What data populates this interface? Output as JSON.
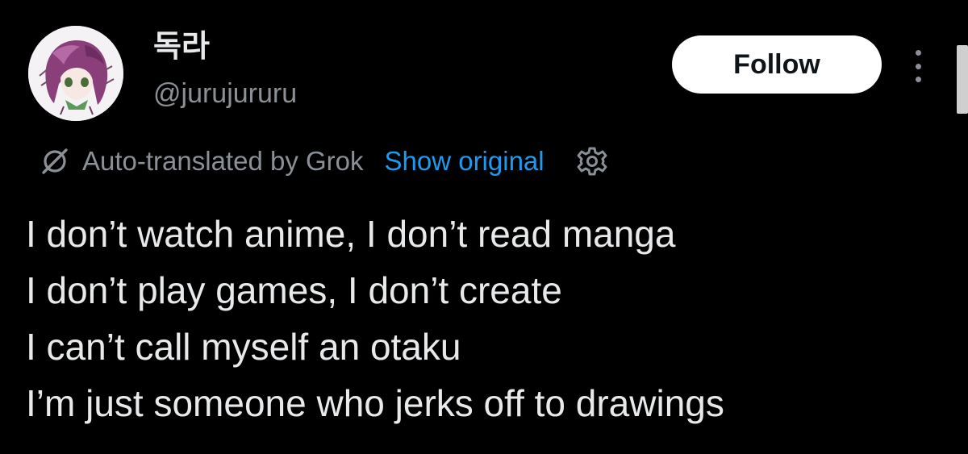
{
  "author": {
    "display_name": "독라",
    "handle": "@jurujururu",
    "avatar_icon": "anime-girl-avatar"
  },
  "actions": {
    "follow_label": "Follow",
    "more_icon": "more-vertical-icon"
  },
  "translation": {
    "icon": "grok-icon",
    "label": "Auto-translated by Grok",
    "show_original_label": "Show original",
    "settings_icon": "gear-icon"
  },
  "tweet": {
    "lines": [
      "I don’t watch anime, I don’t read manga",
      "I don’t play games, I don’t create",
      "I can’t call myself an otaku",
      "I’m just someone who jerks off to drawings"
    ]
  },
  "colors": {
    "background": "#000000",
    "primary_text": "#e7e9ea",
    "secondary_text": "#8b9097",
    "link": "#1d9bf0",
    "follow_button_bg": "#ffffff",
    "follow_button_text": "#0f1419"
  }
}
